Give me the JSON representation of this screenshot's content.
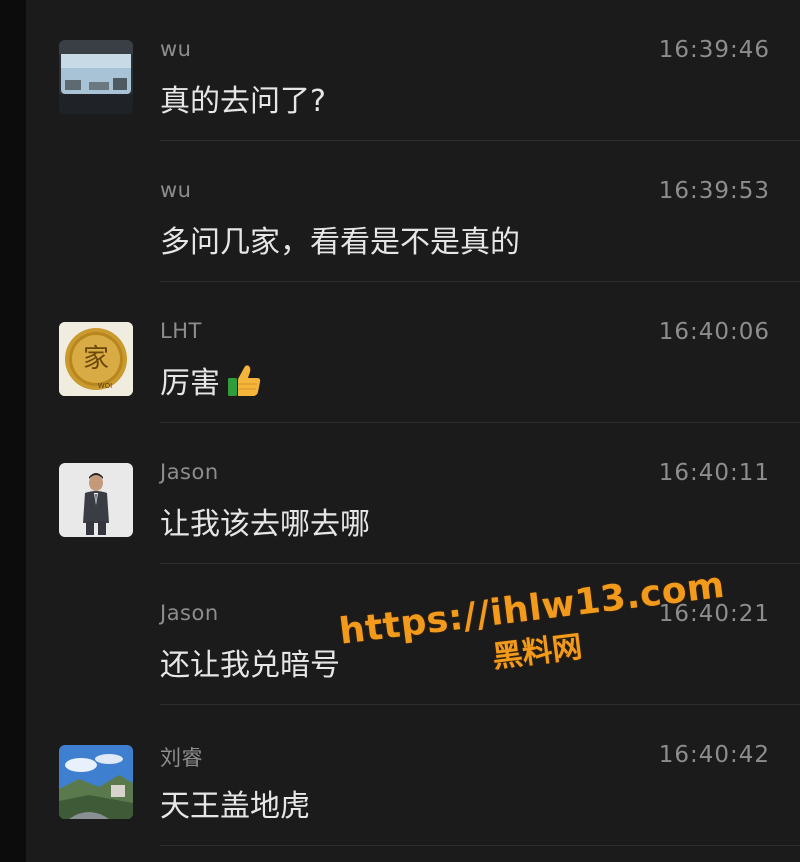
{
  "messages": [
    {
      "sender": "wu",
      "time": "16:39:46",
      "text": "真的去问了?",
      "avatar": "car-window-photo"
    },
    {
      "sender": "wu",
      "time": "16:39:53",
      "text": "多问几家，看看是不是真的",
      "avatar": null
    },
    {
      "sender": "LHT",
      "time": "16:40:06",
      "text": "厉害",
      "emoji": "thumbs-up-icon",
      "avatar": "gold-coin-jia",
      "avatar_text": "家",
      "avatar_subtext": "WOI"
    },
    {
      "sender": "Jason",
      "time": "16:40:11",
      "text": "让我该去哪去哪",
      "avatar": "man-in-suit-photo"
    },
    {
      "sender": "Jason",
      "time": "16:40:21",
      "text": "还让我兑暗号",
      "avatar": null
    },
    {
      "sender": "刘睿",
      "time": "16:40:42",
      "text": "天王盖地虎",
      "avatar": "landscape-photo"
    }
  ],
  "watermark": {
    "url": "https://ihlw13.com",
    "name": "黑料网"
  },
  "colors": {
    "panel_bg": "#1b1b1c",
    "meta_text": "#8d8d8f",
    "body_text": "#e6e6e6",
    "watermark": "#f29a1c"
  }
}
